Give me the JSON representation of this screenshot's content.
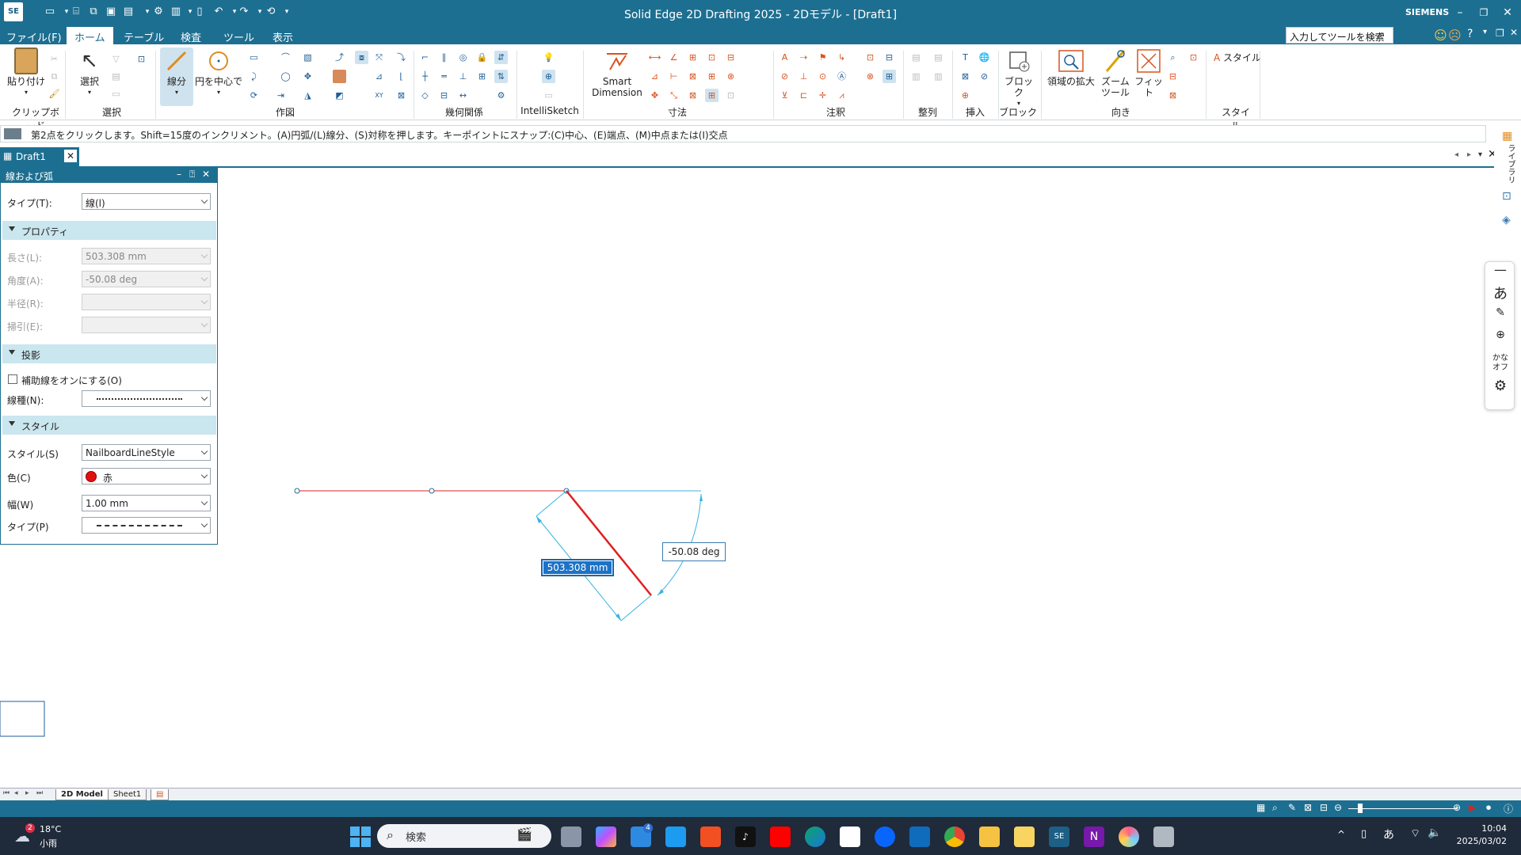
{
  "window": {
    "title": "Solid Edge 2D Drafting 2025 - 2Dモデル - [Draft1]",
    "app_icon": "SE",
    "brand": "SIEMENS"
  },
  "menu": {
    "file": "ファイル(F)",
    "home": "ホーム",
    "table": "テーブル",
    "inspect": "検査",
    "tools": "ツール",
    "view": "表示",
    "search_placeholder": "入力してツールを検索"
  },
  "ribbon": {
    "paste": "貼り付け",
    "select": "選択",
    "line": "線分",
    "circle_center": "円を中心で",
    "smart_dimension_1": "Smart",
    "smart_dimension_2": "Dimension",
    "intellisketch": "IntelliSketch",
    "block": "ブロック",
    "zoom_area": "領域の拡大",
    "zoom_tool_1": "ズーム",
    "zoom_tool_2": "ツール",
    "fit": "フィット",
    "style": "スタイル",
    "groups": {
      "clipboard": "クリップボード",
      "select": "選択",
      "draw": "作図",
      "geometric": "幾何関係",
      "intellisketch": "IntelliSketch",
      "dimension": "寸法",
      "annotation": "注釈",
      "align": "整列",
      "insert": "挿入",
      "block": "ブロック",
      "orient": "向き",
      "style": "スタイル"
    }
  },
  "prompt": "第2点をクリックします。Shift=15度のインクリメント。(A)円弧/(L)線分、(S)対称を押します。キーポイントにスナップ:(C)中心、(E)端点、(M)中点または(I)交点",
  "doc_tab": "Draft1",
  "panel": {
    "title": "線および弧",
    "type_label": "タイプ(T):",
    "type_value": "線(l)",
    "section_props": "プロパティ",
    "length_label": "長さ(L):",
    "length_value": "503.308 mm",
    "angle_label": "角度(A):",
    "angle_value": "-50.08 deg",
    "radius_label": "半径(R):",
    "sweep_label": "掃引(E):",
    "section_projection": "投影",
    "aux_label": "補助線をオンにする(O)",
    "linetype_label": "線種(N):",
    "section_style": "スタイル",
    "style_label": "スタイル(S)",
    "style_value": "NailboardLineStyle",
    "color_label": "色(C)",
    "color_value": "赤",
    "width_label": "幅(W)",
    "width_value": "1.00 mm",
    "dash_label": "タイプ(P)"
  },
  "canvas": {
    "length_readout": "503.308 mm",
    "angle_readout": "-50.08 deg"
  },
  "sheet_tabs": {
    "model": "2D Model",
    "sheet1": "Sheet1"
  },
  "sidebar": {
    "library": "ライブラリ"
  },
  "ime": {
    "char": "あ",
    "kana_off_1": "かな",
    "kana_off_2": "オフ"
  },
  "taskbar": {
    "weather_badge": "2",
    "temperature": "18°C",
    "weather_desc": "小雨",
    "search": "検索",
    "mail_badge": "4",
    "ime": "あ",
    "time": "10:04",
    "date": "2025/03/02"
  },
  "colors": {
    "accent": "#1d6f91",
    "line_red": "#e02020",
    "dim_cyan": "#39b4e0",
    "section_bg": "#cae6ee"
  }
}
